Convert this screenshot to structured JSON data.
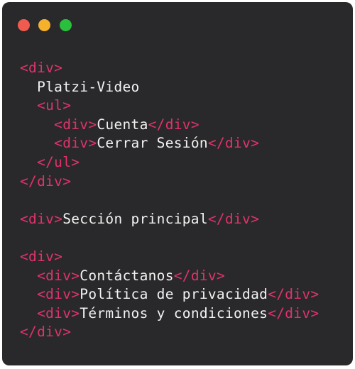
{
  "window": {
    "controls": {
      "close_color": "#f05b4f",
      "minimize_color": "#f5b02c",
      "maximize_color": "#2bbf3e"
    }
  },
  "code": {
    "tag_color": "#e0336b",
    "text_color": "#f2f2f2",
    "lines": [
      {
        "indent": "",
        "open": "<div>",
        "text": "",
        "close": ""
      },
      {
        "indent": "  ",
        "open": "",
        "text": "Platzi-Video",
        "close": ""
      },
      {
        "indent": "  ",
        "open": "<ul>",
        "text": "",
        "close": ""
      },
      {
        "indent": "    ",
        "open": "<div>",
        "text": "Cuenta",
        "close": "</div>"
      },
      {
        "indent": "    ",
        "open": "<div>",
        "text": "Cerrar Sesión",
        "close": "</div>"
      },
      {
        "indent": "  ",
        "open": "</ul>",
        "text": "",
        "close": ""
      },
      {
        "indent": "",
        "open": "</div>",
        "text": "",
        "close": ""
      },
      {
        "indent": "",
        "open": "",
        "text": "",
        "close": ""
      },
      {
        "indent": "",
        "open": "<div>",
        "text": "Sección principal",
        "close": "</div>"
      },
      {
        "indent": "",
        "open": "",
        "text": "",
        "close": ""
      },
      {
        "indent": "",
        "open": "<div>",
        "text": "",
        "close": ""
      },
      {
        "indent": "  ",
        "open": "<div>",
        "text": "Contáctanos",
        "close": "</div>"
      },
      {
        "indent": "  ",
        "open": "<div>",
        "text": "Política de privacidad",
        "close": "</div>"
      },
      {
        "indent": "  ",
        "open": "<div>",
        "text": "Términos y condiciones",
        "close": "</div>"
      },
      {
        "indent": "",
        "open": "</div>",
        "text": "",
        "close": ""
      }
    ]
  }
}
